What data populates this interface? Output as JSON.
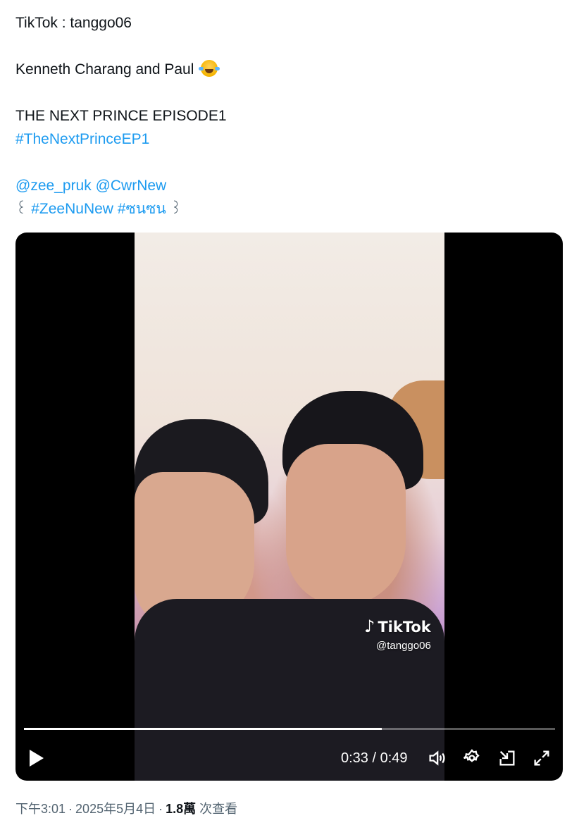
{
  "tweet": {
    "line1": "TikTok : tanggo06",
    "line2": "Kenneth Charang and Paul",
    "line3": "THE NEXT PRINCE EPISODE1",
    "hashtag1": "#TheNextPrinceEP1",
    "mention1": "@zee_pruk",
    "mention2": "@CwrNew",
    "bracket_open": "꒰",
    "hashtag2": "#ZeeNuNew",
    "hashtag3": "#ซนซน",
    "bracket_close": "꒱",
    "emoji_icon": "face-with-tears-of-joy-emoji"
  },
  "video": {
    "watermark_brand": "TikTok",
    "watermark_handle": "@tanggo06",
    "current_time": "0:33",
    "separator": " / ",
    "duration": "0:49",
    "progress_fraction": 0.674,
    "icons": [
      "play-icon",
      "volume-icon",
      "settings-icon",
      "dock-icon",
      "fullscreen-icon"
    ]
  },
  "meta": {
    "time": "下午3:01",
    "date": "2025年5月4日",
    "views_count": "1.8萬",
    "views_label": "次查看"
  }
}
